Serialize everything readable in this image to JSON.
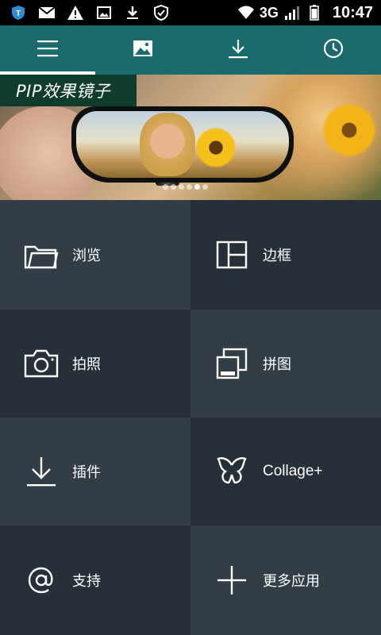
{
  "status_bar": {
    "icons": [
      "shield-t-icon",
      "mail-icon",
      "warning-icon",
      "image-icon",
      "download-icon",
      "security-shield-icon"
    ],
    "network": "3G",
    "time": "10:47"
  },
  "tabs": [
    {
      "name": "menu",
      "icon": "hamburger-icon",
      "active": true
    },
    {
      "name": "gallery",
      "icon": "image-icon",
      "active": false
    },
    {
      "name": "downloads",
      "icon": "download-icon",
      "active": false
    },
    {
      "name": "history",
      "icon": "clock-icon",
      "active": false
    }
  ],
  "banner": {
    "title": "PIP效果镜子",
    "dots_total": 6,
    "dots_active_index": 4
  },
  "tiles": {
    "browse": {
      "label": "浏览",
      "icon": "folder-icon"
    },
    "frames": {
      "label": "边框",
      "icon": "frame-layout-icon"
    },
    "camera": {
      "label": "拍照",
      "icon": "camera-icon"
    },
    "collage": {
      "label": "拼图",
      "icon": "stacked-photos-icon"
    },
    "plugins": {
      "label": "插件",
      "icon": "download-icon"
    },
    "collage_plus": {
      "label": "Collage+",
      "icon": "butterfly-icon"
    },
    "support": {
      "label": "支持",
      "icon": "at-sign-icon"
    },
    "more_apps": {
      "label": "更多应用",
      "icon": "plus-icon"
    }
  },
  "colors": {
    "tabbar": "#1b6b6e",
    "tile_dark": "#273038",
    "tile_light": "#333d45",
    "banner_title_bg": "#103c30"
  }
}
